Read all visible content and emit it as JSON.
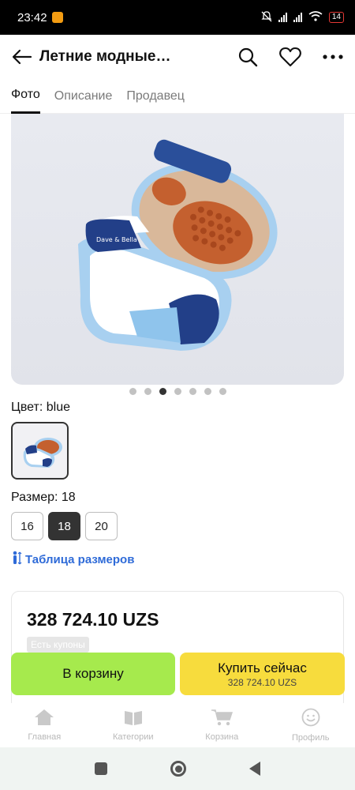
{
  "status_bar": {
    "time": "23:42",
    "battery": "14"
  },
  "header": {
    "title": "Летние модные…"
  },
  "tabs": [
    {
      "label": "Фото",
      "active": true
    },
    {
      "label": "Описание",
      "active": false
    },
    {
      "label": "Продавец",
      "active": false
    }
  ],
  "gallery": {
    "page_count": 7,
    "active_index": 2
  },
  "color": {
    "label": "Цвет: blue"
  },
  "size": {
    "label": "Размер: 18",
    "options": [
      "16",
      "18",
      "20"
    ],
    "selected": "18"
  },
  "size_table_link": "Таблица размеров",
  "price_card": {
    "price": "328 724.10 UZS",
    "coupon": "Есть купоны"
  },
  "actions": {
    "add_to_cart": "В корзину",
    "buy_now": "Купить сейчас",
    "buy_now_price": "328 724.10 UZS"
  },
  "bottom_nav": [
    {
      "label": "Главная",
      "icon": "home-icon"
    },
    {
      "label": "Категории",
      "icon": "catalog-icon"
    },
    {
      "label": "Корзина",
      "icon": "cart-icon"
    },
    {
      "label": "Профиль",
      "icon": "profile-icon"
    }
  ],
  "colors": {
    "add_to_cart_bg": "#a6ea4d",
    "buy_now_bg": "#f7dc3d",
    "link": "#2f6bd8"
  }
}
